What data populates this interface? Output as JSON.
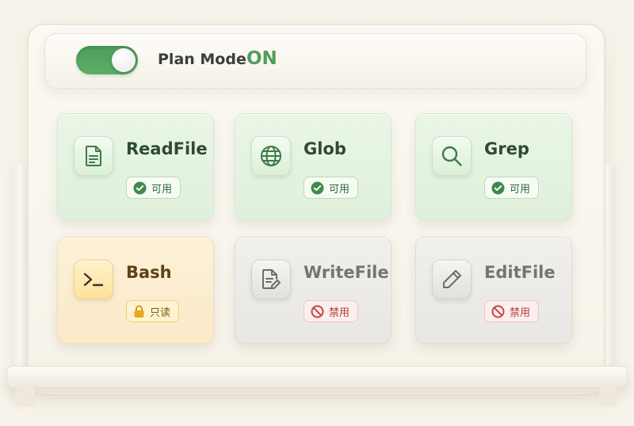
{
  "header": {
    "label": "Plan Mode",
    "state": "ON",
    "toggle_on": true
  },
  "tools": [
    {
      "name": "ReadFile",
      "status": "可用",
      "icon": "file-text-icon",
      "badge_icon": "check-circle-icon",
      "tone": "green"
    },
    {
      "name": "Glob",
      "status": "可用",
      "icon": "globe-icon",
      "badge_icon": "check-circle-icon",
      "tone": "green"
    },
    {
      "name": "Grep",
      "status": "可用",
      "icon": "search-icon",
      "badge_icon": "check-circle-icon",
      "tone": "green"
    },
    {
      "name": "Bash",
      "status": "只读",
      "icon": "terminal-icon",
      "badge_icon": "lock-icon",
      "tone": "yellow"
    },
    {
      "name": "WriteFile",
      "status": "禁用",
      "icon": "file-edit-icon",
      "badge_icon": "forbidden-icon",
      "tone": "gray"
    },
    {
      "name": "EditFile",
      "status": "禁用",
      "icon": "pencil-icon",
      "badge_icon": "forbidden-icon",
      "tone": "gray"
    }
  ],
  "colors": {
    "accent_green": "#4f9e5b",
    "available_text": "#2f6a3a",
    "readonly_text": "#7a5a14",
    "disabled_text": "#b83a34"
  }
}
